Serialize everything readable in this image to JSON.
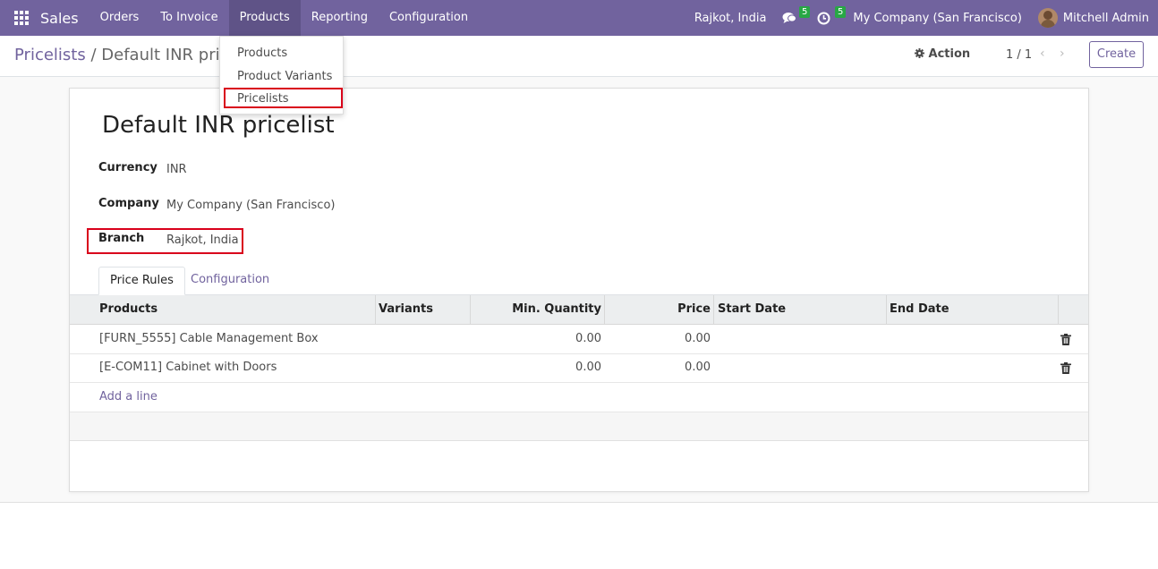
{
  "navbar": {
    "app_name": "Sales",
    "menu": [
      "Orders",
      "To Invoice",
      "Products",
      "Reporting",
      "Configuration"
    ],
    "branch": "Rajkot, India",
    "messages_count": "5",
    "activities_count": "5",
    "company": "My Company (San Francisco)",
    "user": "Mitchell Admin",
    "bg_color": "#71639e"
  },
  "dropdown": {
    "items": [
      "Products",
      "Product Variants",
      "Pricelists"
    ],
    "highlighted": "Pricelists"
  },
  "control": {
    "breadcrumb_parent": "Pricelists",
    "breadcrumb_separator": "/",
    "breadcrumb_current": "Default INR pricelist",
    "action_label": "Action",
    "pager": "1 / 1",
    "create_label": "Create"
  },
  "form": {
    "title": "Default INR pricelist",
    "fields": [
      {
        "label": "Currency",
        "value": "INR"
      },
      {
        "label": "Company",
        "value": "My Company (San Francisco)"
      },
      {
        "label": "Branch",
        "value": "Rajkot, India"
      }
    ],
    "tabs": [
      "Price Rules",
      "Configuration"
    ],
    "active_tab": "Price Rules"
  },
  "table": {
    "columns": [
      "Products",
      "Variants",
      "Min. Quantity",
      "Price",
      "Start Date",
      "End Date"
    ],
    "rows": [
      {
        "product": "[FURN_5555] Cable Management Box",
        "variants": "",
        "min_qty": "0.00",
        "price": "0.00",
        "start": "",
        "end": ""
      },
      {
        "product": "[E-COM11] Cabinet with Doors",
        "variants": "",
        "min_qty": "0.00",
        "price": "0.00",
        "start": "",
        "end": ""
      }
    ],
    "add_line": "Add a line"
  },
  "icons": {
    "apps": "grid-icon",
    "messages": "chat-icon",
    "activities": "clock-icon",
    "action": "gear-icon",
    "prev": "chevron-left-icon",
    "next": "chevron-right-icon",
    "delete": "trash-icon"
  },
  "highlight_color": "#d9001b"
}
